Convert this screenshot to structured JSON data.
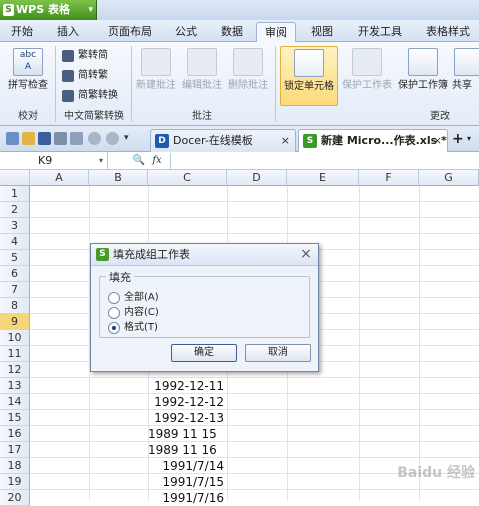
{
  "app": {
    "name": "WPS 表格",
    "logo": "S"
  },
  "menu_tabs": [
    "开始",
    "插入",
    "页面布局",
    "公式",
    "数据",
    "审阅",
    "视图",
    "开发工具",
    "表格样式"
  ],
  "active_tab": "审阅",
  "ribbon": {
    "proofing": {
      "label": "校对",
      "spell_check": "拼写检查"
    },
    "chinese_convert": {
      "label": "中文简繁转换",
      "trad_to_simp": "繁转简",
      "simp_to_trad": "简转繁",
      "convert": "简繁转换"
    },
    "comments": {
      "label": "批注",
      "new": "新建批注",
      "edit": "编辑批注",
      "delete": "删除批注"
    },
    "changes": {
      "label": "更改",
      "lock_cell": "锁定单元格",
      "protect_sheet": "保护工作表",
      "protect_workbook": "保护工作簿",
      "share": "共享"
    }
  },
  "doc_tabs": {
    "docer": "Docer-在线模板",
    "workbook": "新建 Micro...作表.xls *",
    "add": "+"
  },
  "formula_bar": {
    "cell_ref": "K9",
    "fx": "fx"
  },
  "columns": [
    "A",
    "B",
    "C",
    "D",
    "E",
    "F",
    "G"
  ],
  "rows": [
    "1",
    "2",
    "3",
    "4",
    "5",
    "6",
    "7",
    "8",
    "9",
    "10",
    "11",
    "12",
    "13",
    "14",
    "15",
    "16",
    "17",
    "18",
    "19",
    "20"
  ],
  "selected_row": "9",
  "cells_c": [
    {
      "row": "13",
      "value": "1992-12-11"
    },
    {
      "row": "14",
      "value": "1992-12-12"
    },
    {
      "row": "15",
      "value": "1992-12-13"
    },
    {
      "row": "16",
      "value": "1989 11 15"
    },
    {
      "row": "17",
      "value": "1989 11 16"
    },
    {
      "row": "18",
      "value": "1991/7/14"
    },
    {
      "row": "19",
      "value": "1991/7/15"
    },
    {
      "row": "20",
      "value": "1991/7/16"
    }
  ],
  "dialog": {
    "title": "填充成组工作表",
    "group_label": "填充",
    "options": [
      "全部(A)",
      "内容(C)",
      "格式(T)"
    ],
    "selected_option": 2,
    "ok": "确定",
    "cancel": "取消"
  },
  "watermark": "Baidu 经验"
}
